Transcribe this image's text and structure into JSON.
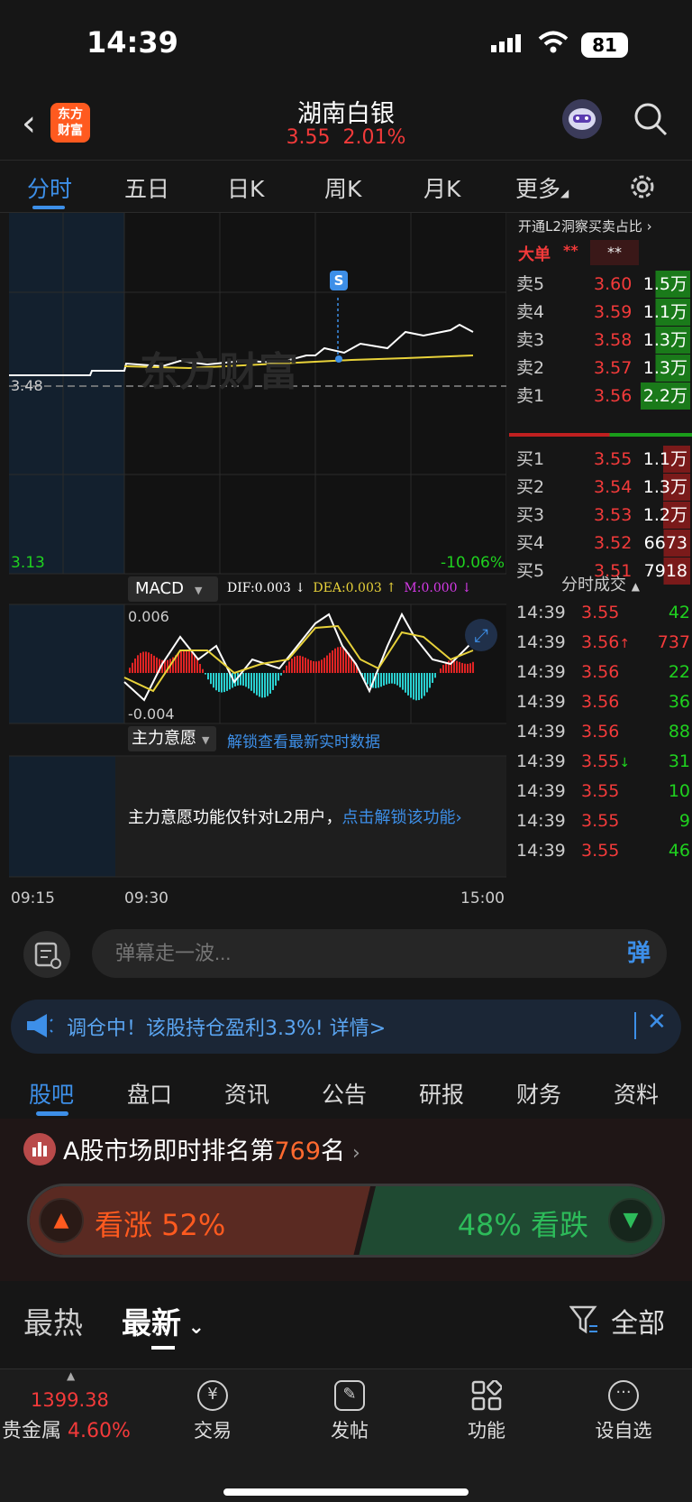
{
  "status": {
    "time": "14:39",
    "battery": "81"
  },
  "header": {
    "logo_line1": "东方",
    "logo_line2": "财富",
    "title": "湖南白银",
    "price": "3.55",
    "change": "2.01%"
  },
  "tabs": {
    "active": "分时",
    "items": [
      "分时",
      "五日",
      "日K",
      "周K",
      "月K",
      "更多"
    ]
  },
  "chart": {
    "base_price": "3.48",
    "low_label": "3.13",
    "low_pct": "-10.06%",
    "s_marker": "S",
    "watermark": "东方财富",
    "times": [
      "09:15",
      "09:30",
      "15:00"
    ],
    "macd": {
      "name": "MACD",
      "dif": "DIF:0.003",
      "dea": "DEA:0.003",
      "m": "M:0.000",
      "max": "0.006",
      "min": "-0.004"
    },
    "main_force": {
      "name": "主力意愿",
      "unlock": "解锁查看最新实时数据",
      "message": "主力意愿功能仅针对L2用户，",
      "link": "点击解锁该功能"
    }
  },
  "book": {
    "header": "开通L2洞察买卖占比",
    "big_order": "大单",
    "big_order_val1": "**",
    "big_order_val2": "**",
    "sells": [
      {
        "label": "卖5",
        "price": "3.60",
        "vol": "1.5万"
      },
      {
        "label": "卖4",
        "price": "3.59",
        "vol": "1.1万"
      },
      {
        "label": "卖3",
        "price": "3.58",
        "vol": "1.3万"
      },
      {
        "label": "卖2",
        "price": "3.57",
        "vol": "1.3万"
      },
      {
        "label": "卖1",
        "price": "3.56",
        "vol": "2.2万"
      }
    ],
    "buys": [
      {
        "label": "买1",
        "price": "3.55",
        "vol": "1.1万"
      },
      {
        "label": "买2",
        "price": "3.54",
        "vol": "1.3万"
      },
      {
        "label": "买3",
        "price": "3.53",
        "vol": "1.2万"
      },
      {
        "label": "买4",
        "price": "3.52",
        "vol": "6673"
      },
      {
        "label": "买5",
        "price": "3.51",
        "vol": "7918"
      }
    ],
    "trades_title": "分时成交",
    "trades": [
      {
        "time": "14:39",
        "price": "3.55",
        "vol": "42",
        "dir": ""
      },
      {
        "time": "14:39",
        "price": "3.56",
        "vol": "737",
        "dir": "↑"
      },
      {
        "time": "14:39",
        "price": "3.56",
        "vol": "22",
        "dir": ""
      },
      {
        "time": "14:39",
        "price": "3.56",
        "vol": "36",
        "dir": ""
      },
      {
        "time": "14:39",
        "price": "3.56",
        "vol": "88",
        "dir": ""
      },
      {
        "time": "14:39",
        "price": "3.55",
        "vol": "31",
        "dir": "↓"
      },
      {
        "time": "14:39",
        "price": "3.55",
        "vol": "10",
        "dir": ""
      },
      {
        "time": "14:39",
        "price": "3.55",
        "vol": "9",
        "dir": ""
      },
      {
        "time": "14:39",
        "price": "3.55",
        "vol": "46",
        "dir": ""
      }
    ]
  },
  "danmu": {
    "placeholder": "弹幕走一波...",
    "send": "弹"
  },
  "notice": {
    "text": "调仓中！该股持仓盈利3.3%! 详情>"
  },
  "sections": {
    "items": [
      "股吧",
      "盘口",
      "资讯",
      "公告",
      "研报",
      "财务",
      "资料"
    ],
    "active": "股吧"
  },
  "rank": {
    "prefix": "A股市场即时排名第",
    "num": "769",
    "suffix": "名"
  },
  "vote": {
    "bull": "看涨 52%",
    "bear": "48% 看跌"
  },
  "feed": {
    "hot": "最热",
    "new": "最新",
    "filter": "全部"
  },
  "bottom_nav": {
    "index_value": "1399.38",
    "index_name": "贵金属",
    "index_change": "4.60%",
    "items": [
      "交易",
      "发帖",
      "功能",
      "设自选"
    ]
  },
  "colors": {
    "up": "#f23a3a",
    "down": "#1fd11f",
    "accent": "#3d8fe8",
    "brand": "#ff5a1f"
  }
}
